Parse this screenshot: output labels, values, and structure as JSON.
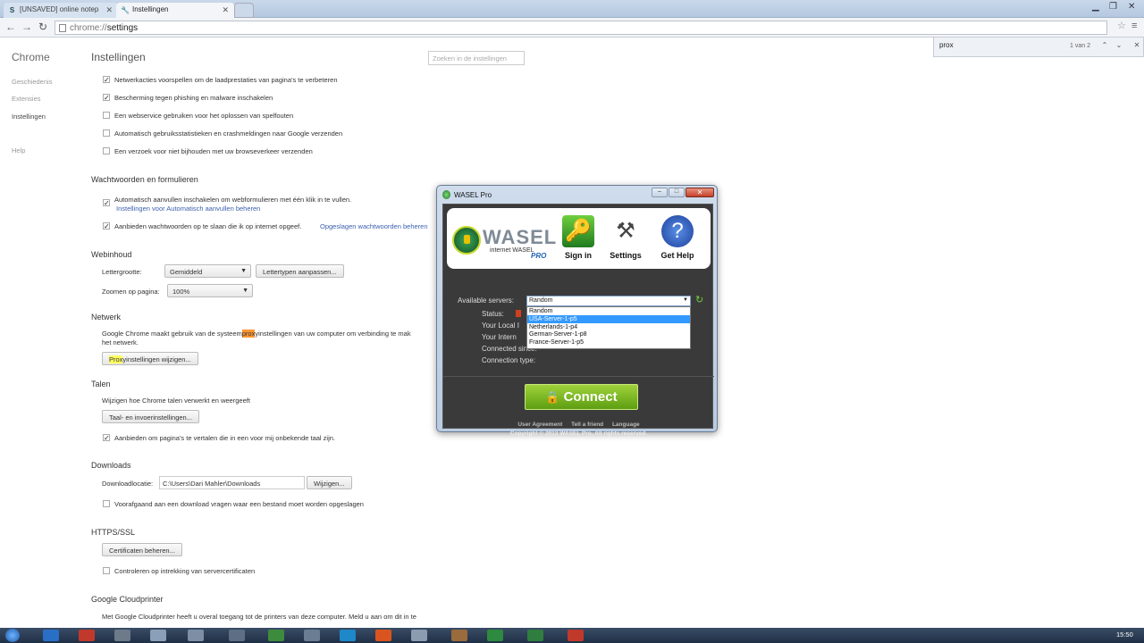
{
  "tabs": [
    {
      "title": "[UNSAVED] online notep",
      "icon": "S"
    },
    {
      "title": "Instellingen",
      "icon": "wrench"
    }
  ],
  "omnibox": {
    "scheme": "chrome://",
    "path": "settings"
  },
  "find": {
    "query": "prox",
    "count": "1 van 2"
  },
  "sidebar": {
    "title": "Chrome",
    "items": [
      "Geschiedenis",
      "Extensies",
      "Instellingen",
      "Help"
    ]
  },
  "main": {
    "title": "Instellingen",
    "search_placeholder": "Zoeken in de instellingen",
    "privacy": [
      {
        "label": "Netwerkacties voorspellen om de laadprestaties van pagina's te verbeteren",
        "checked": true
      },
      {
        "label": "Bescherming tegen phishing en malware inschakelen",
        "checked": true
      },
      {
        "label": "Een webservice gebruiken voor het oplossen van spelfouten",
        "checked": false
      },
      {
        "label": "Automatisch gebruiksstatistieken en crashmeldingen naar Google verzenden",
        "checked": false
      },
      {
        "label": "Een verzoek voor niet bijhouden met uw browseverkeer verzenden",
        "checked": false
      }
    ],
    "passwords": {
      "heading": "Wachtwoorden en formulieren",
      "autofill": "Automatisch aanvullen inschakelen om webformulieren met één klik in te vullen.",
      "autofill_link": "Instellingen voor Automatisch aanvullen beheren",
      "save": "Aanbieden wachtwoorden op te slaan die ik op internet opgeef.",
      "save_link": "Opgeslagen wachtwoorden beheren"
    },
    "web": {
      "heading": "Webinhoud",
      "font_label": "Lettergrootte:",
      "font_value": "Gemiddeld",
      "font_button": "Lettertypen aanpassen...",
      "zoom_label": "Zoomen op pagina:",
      "zoom_value": "100%"
    },
    "network": {
      "heading": "Netwerk",
      "text_a": "Google Chrome maakt gebruik van de systeem",
      "text_hl": "prox",
      "text_b": "yinstellingen van uw computer om verbinding te mak",
      "text_c": "het netwerk.",
      "btn_hl": "Prox",
      "btn_rest": "yinstellingen wijzigen..."
    },
    "languages": {
      "heading": "Talen",
      "text": "Wijzigen hoe Chrome talen verwerkt en weergeeft",
      "button": "Taal- en invoerinstellingen...",
      "translate": "Aanbieden om pagina's te vertalen die in een voor mij onbekende taal zijn."
    },
    "downloads": {
      "heading": "Downloads",
      "label": "Downloadlocatie:",
      "path": "C:\\Users\\Dari Mahler\\Downloads",
      "button": "Wijzigen...",
      "ask": "Voorafgaand aan een download vragen waar een bestand moet worden opgeslagen"
    },
    "https": {
      "heading": "HTTPS/SSL",
      "button": "Certificaten beheren...",
      "check": "Controleren op intrekking van servercertificaten"
    },
    "cloudprint": {
      "heading": "Google Cloudprinter",
      "text": "Met Google Cloudprinter heeft u overal toegang tot de printers van deze computer. Meld u aan om dit in te"
    }
  },
  "wasel": {
    "title": "WASEL Pro",
    "logo": "WASEL",
    "logo_sub": "internet WASEL",
    "logo_pro": "PRO",
    "tools": [
      "Sign in",
      "Settings",
      "Get Help"
    ],
    "available_label": "Available servers:",
    "selected_server": "Random",
    "servers": [
      "Random",
      "USA-Server-1-p5",
      "Netherlands-1-p4",
      "German-Server-1-p8",
      "France-Server-1-p5"
    ],
    "info": [
      "Status:",
      "Your Local I",
      "Your Intern",
      "Connected since:",
      "Connection type:"
    ],
    "connect": "Connect",
    "links": [
      "User Agreement",
      "Tell a friend",
      "Language"
    ],
    "copyright": "Copyright © 2013 WASEL Pro, All rights reserved."
  },
  "taskbar": {
    "clock": "15:50"
  },
  "colors": {
    "accent": "#3399ff",
    "connect_green": "#7cbf22",
    "find_highlight": "#ff9632"
  }
}
